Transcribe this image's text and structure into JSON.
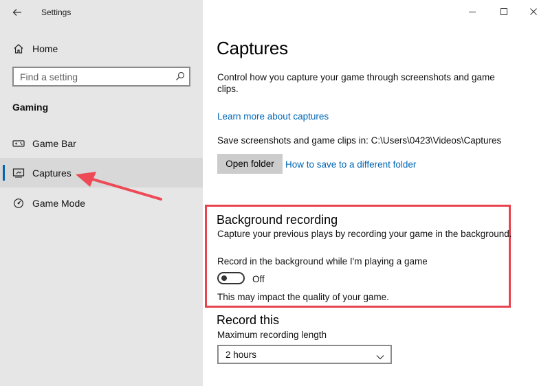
{
  "window": {
    "title": "Settings",
    "controls": [
      "minimize",
      "maximize",
      "close"
    ]
  },
  "sidebar": {
    "home_label": "Home",
    "search_placeholder": "Find a setting",
    "section_label": "Gaming",
    "items": [
      {
        "label": "Game Bar",
        "icon": "game-bar-icon",
        "selected": false
      },
      {
        "label": "Captures",
        "icon": "captures-icon",
        "selected": true
      },
      {
        "label": "Game Mode",
        "icon": "game-mode-icon",
        "selected": false
      }
    ]
  },
  "main": {
    "title": "Captures",
    "description": "Control how you capture your game through screenshots and game clips.",
    "learn_more_link": "Learn more about captures",
    "save_path_text": "Save screenshots and game clips in: C:\\Users\\0423\\Videos\\Captures",
    "open_folder_button": "Open folder",
    "different_folder_link": "How to save to a different folder",
    "background_recording": {
      "title": "Background recording",
      "description": "Capture your previous plays by recording your game in the background.",
      "toggle_label": "Record in the background while I'm playing a game",
      "toggle_state": "Off",
      "toggle_on": false,
      "note": "This may impact the quality of your game."
    },
    "record_this": {
      "title": "Record this",
      "max_length_label": "Maximum recording length",
      "max_length_value": "2 hours"
    }
  },
  "colors": {
    "accent": "#0063b1",
    "link": "#0066b4",
    "highlight": "#e8434f",
    "sidebar_bg": "#e6e6e6"
  }
}
